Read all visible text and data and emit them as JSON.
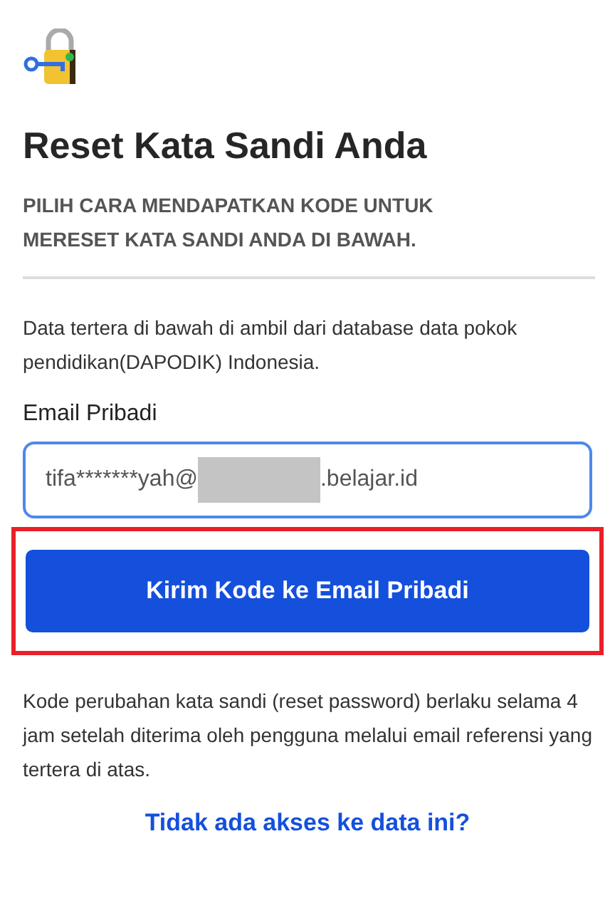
{
  "title": "Reset Kata Sandi Anda",
  "subtitle": "PILIH CARA MENDAPATKAN KODE UNTUK MERESET KATA SANDI ANDA DI BAWAH.",
  "info": "Data tertera di bawah di ambil dari database data pokok pendidikan(DAPODIK) Indonesia.",
  "email_field": {
    "label": "Email Pribadi",
    "value_before": "tifa*******yah@",
    "redacted": true,
    "value_after": ".belajar.id",
    "focused": true
  },
  "send_button": {
    "label": "Kirim Kode ke Email Pribadi",
    "highlighted": true
  },
  "note": "Kode perubahan kata sandi (reset password) berlaku selama 4 jam setelah diterima oleh pengguna melalui email referensi yang tertera di atas.",
  "link": "Tidak ada akses ke data ini?"
}
